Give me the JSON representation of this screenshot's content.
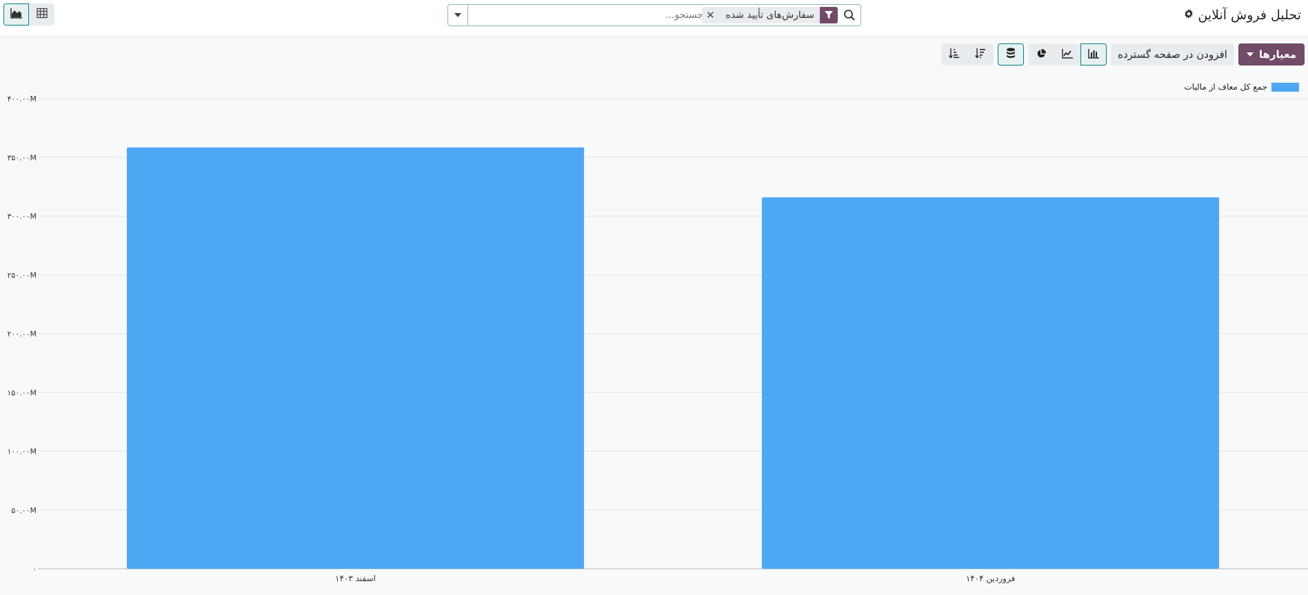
{
  "app": {
    "title": "تحلیل فروش آنلاین"
  },
  "search": {
    "facet_label": "سفارش‌های تأیید شده",
    "placeholder": "جستجو..."
  },
  "toolbar": {
    "measures_label": "معیارها",
    "insert_label": "افزودن در صفحه گسترده"
  },
  "icons": {
    "gear": "gear-icon",
    "search": "search-icon",
    "filter": "filter-icon",
    "close": "close-icon",
    "bar_chart": "bar-chart-icon",
    "line_chart": "line-chart-icon",
    "pie_chart": "pie-chart-icon",
    "stacked": "database-icon",
    "sort_desc": "sort-descending-icon",
    "sort_asc": "sort-ascending-icon",
    "graph_view": "area-chart-icon",
    "pivot_view": "table-icon"
  },
  "colors": {
    "brand": "#714b67",
    "accent": "#017e84",
    "bar": "#4ea7f2"
  },
  "chart_data": {
    "type": "bar",
    "categories": [
      "اسفند ۱۴۰۳",
      "فروردین ۱۴۰۴"
    ],
    "series": [
      {
        "name": "جمع کل معاف از مالیات",
        "values": [
          358.5,
          316
        ]
      }
    ],
    "yticks": [
      "۰",
      "۵۰.۰۰M",
      "۱۰۰.۰۰M",
      "۱۵۰.۰۰M",
      "۲۰۰.۰۰M",
      "۲۵۰.۰۰M",
      "۳۰۰.۰۰M",
      "۳۵۰.۰۰M",
      "۴۰۰.۰۰M"
    ],
    "ylim": [
      0,
      400
    ],
    "grid": true,
    "legend": "top-right"
  }
}
